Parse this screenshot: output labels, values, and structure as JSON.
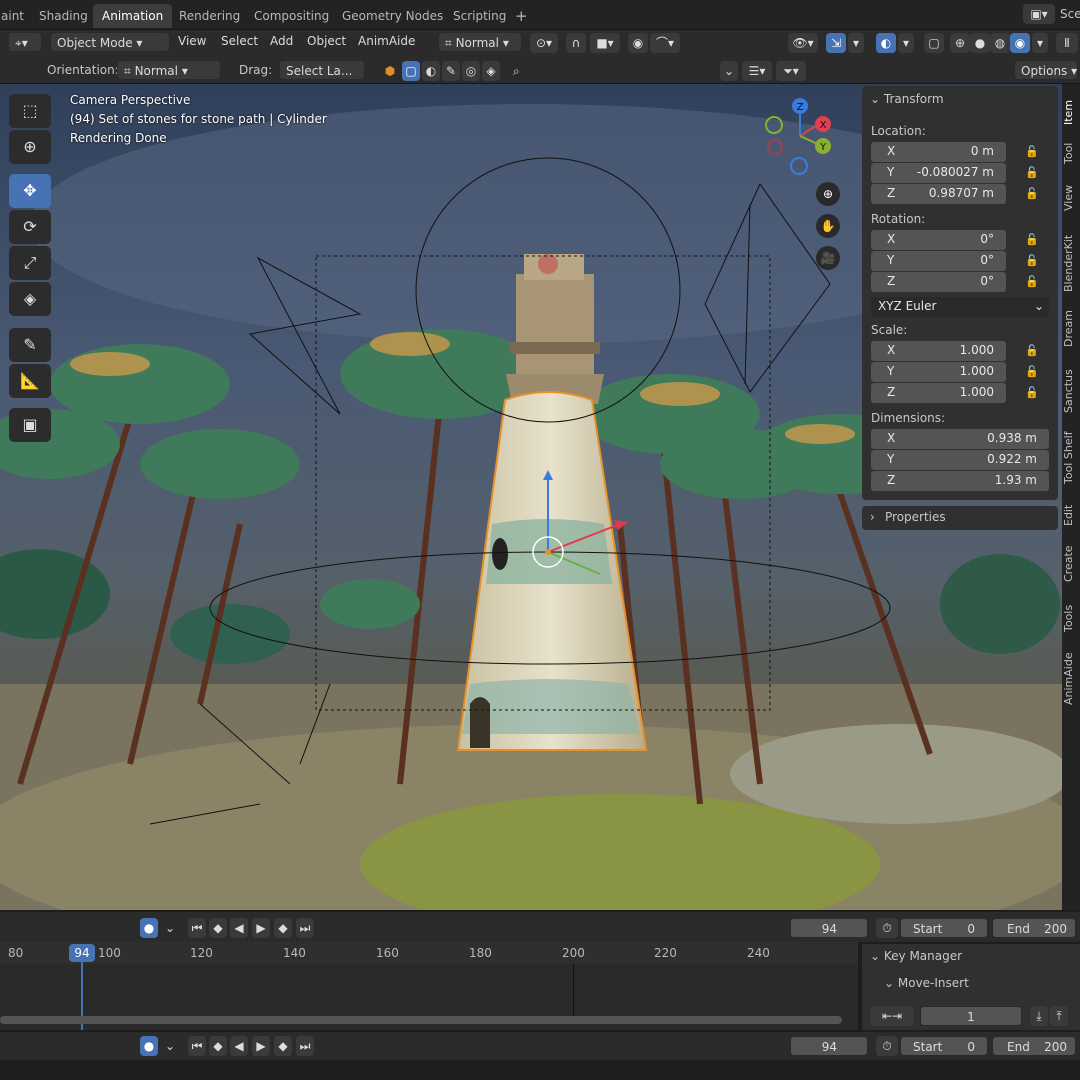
{
  "workspace_tabs": [
    "aint",
    "Shading",
    "Animation",
    "Rendering",
    "Compositing",
    "Geometry Nodes",
    "Scripting"
  ],
  "add_tab_label": "+",
  "scene_label": "Sce",
  "header": {
    "mode": "Object Mode",
    "menus": [
      "View",
      "Select",
      "Add",
      "Object",
      "AnimAide"
    ],
    "transform_orientation": "Normal"
  },
  "tool_settings": {
    "orientation_label": "Orientation:",
    "orientation_value": "Normal",
    "drag_label": "Drag:",
    "drag_value": "Select La...",
    "options_label": "Options"
  },
  "viewport": {
    "line1": "Camera Perspective",
    "line2": "(94) Set of stones for stone path | Cylinder",
    "line3": "Rendering Done",
    "gizmo_axes": [
      "Z",
      "X",
      "Y"
    ]
  },
  "transform_panel": {
    "title": "Transform",
    "location_label": "Location:",
    "location": [
      {
        "axis": "X",
        "value": "0 m"
      },
      {
        "axis": "Y",
        "value": "-0.080027 m"
      },
      {
        "axis": "Z",
        "value": "0.98707 m"
      }
    ],
    "rotation_label": "Rotation:",
    "rotation": [
      {
        "axis": "X",
        "value": "0°"
      },
      {
        "axis": "Y",
        "value": "0°"
      },
      {
        "axis": "Z",
        "value": "0°"
      }
    ],
    "rotation_mode": "XYZ Euler",
    "scale_label": "Scale:",
    "scale": [
      {
        "axis": "X",
        "value": "1.000"
      },
      {
        "axis": "Y",
        "value": "1.000"
      },
      {
        "axis": "Z",
        "value": "1.000"
      }
    ],
    "dimensions_label": "Dimensions:",
    "dimensions": [
      {
        "axis": "X",
        "value": "0.938 m"
      },
      {
        "axis": "Y",
        "value": "0.922 m"
      },
      {
        "axis": "Z",
        "value": "1.93 m"
      }
    ]
  },
  "properties_panel": {
    "title": "Properties"
  },
  "side_tabs": [
    "Item",
    "Tool",
    "View",
    "BlenderKit",
    "Dream",
    "Sanctus",
    "Tool Shelf",
    "Edit",
    "Create",
    "Tools",
    "AnimAide"
  ],
  "timeline": {
    "current_frame": "94",
    "start_label": "Start",
    "start_value": "0",
    "end_label": "End",
    "end_value": "200",
    "frame_ticks": [
      "80",
      "100",
      "120",
      "140",
      "160",
      "180",
      "200",
      "220",
      "240"
    ]
  },
  "key_manager": {
    "title": "Key Manager",
    "subsection": "Move-Insert",
    "value": "1"
  },
  "colors": {
    "accent": "#4772b3",
    "panel": "#303030",
    "field": "#545454"
  }
}
